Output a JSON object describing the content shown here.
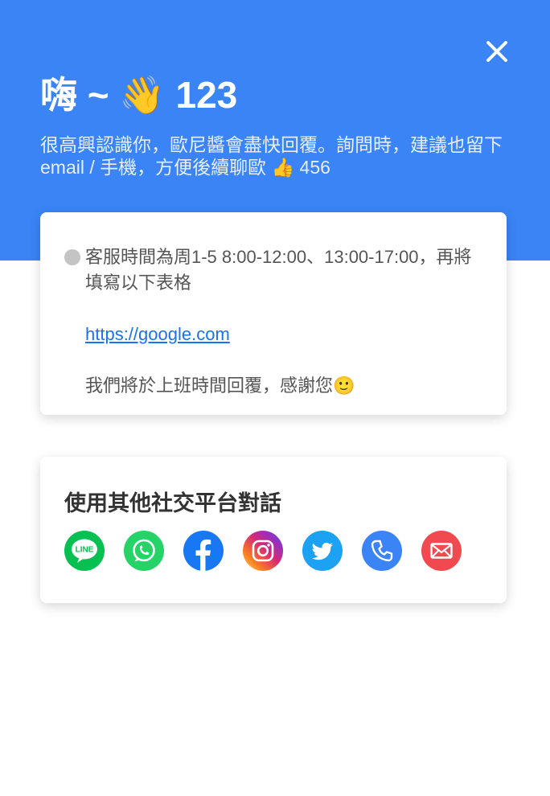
{
  "header": {
    "title": "嗨 ~ 👋 123",
    "subtitle": "很高興認識你，歐尼醬會盡快回覆。詢問時，建議也留下 email / 手機，方便後續聊歐 👍 456",
    "background_color": "#3a84f6"
  },
  "close_button": {
    "icon": "close-icon"
  },
  "message_card": {
    "hours_text": "客服時間為周1-5 8:00-12:00、13:00-17:00，再將填寫以下表格",
    "link_text": "https://google.com",
    "thanks_text": "我們將於上班時間回覆，感謝您🙂"
  },
  "social_card": {
    "title": "使用其他社交平台對話",
    "platforms": [
      {
        "name": "LINE",
        "icon": "line-icon",
        "color": "#06c152",
        "label": "LINE"
      },
      {
        "name": "WhatsApp",
        "icon": "whatsapp-icon",
        "color": "#25d366"
      },
      {
        "name": "Facebook",
        "icon": "facebook-icon",
        "color": "#1877f2"
      },
      {
        "name": "Instagram",
        "icon": "instagram-icon",
        "color": "#d62976"
      },
      {
        "name": "Twitter",
        "icon": "twitter-icon",
        "color": "#1da1f2"
      },
      {
        "name": "Phone",
        "icon": "phone-icon",
        "color": "#3a84f6"
      },
      {
        "name": "Email",
        "icon": "email-icon",
        "color": "#f0494f"
      }
    ]
  }
}
